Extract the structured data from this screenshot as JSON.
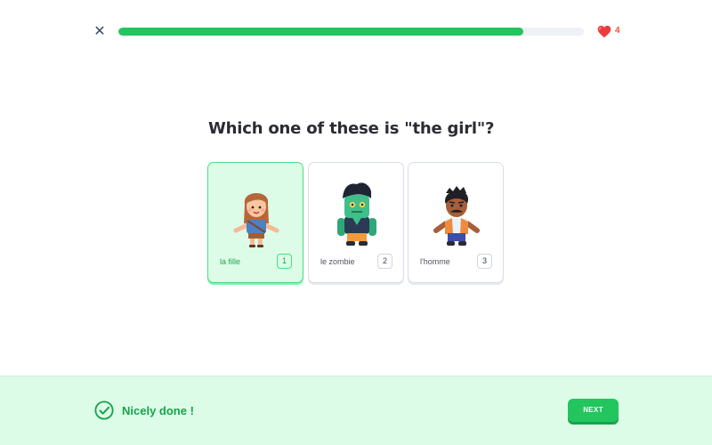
{
  "header": {
    "close_icon": "close-icon",
    "progress": 0.87,
    "progress_color": "#22c55e",
    "lives": "4",
    "lives_icon": "heart-icon"
  },
  "question": {
    "text": "Which one of these is \"the girl\"?"
  },
  "options": [
    {
      "label": "la fille",
      "key": "1",
      "selected": true,
      "icon": "girl-character-icon"
    },
    {
      "label": "le zombie",
      "key": "2",
      "selected": false,
      "icon": "zombie-character-icon"
    },
    {
      "label": "l'homme",
      "key": "3",
      "selected": false,
      "icon": "man-character-icon"
    }
  ],
  "footer": {
    "feedback": "Nicely done !",
    "feedback_icon": "check-circle-icon",
    "next_label": "NEXT",
    "accent": "#22c55e",
    "background": "#dcfce7"
  }
}
